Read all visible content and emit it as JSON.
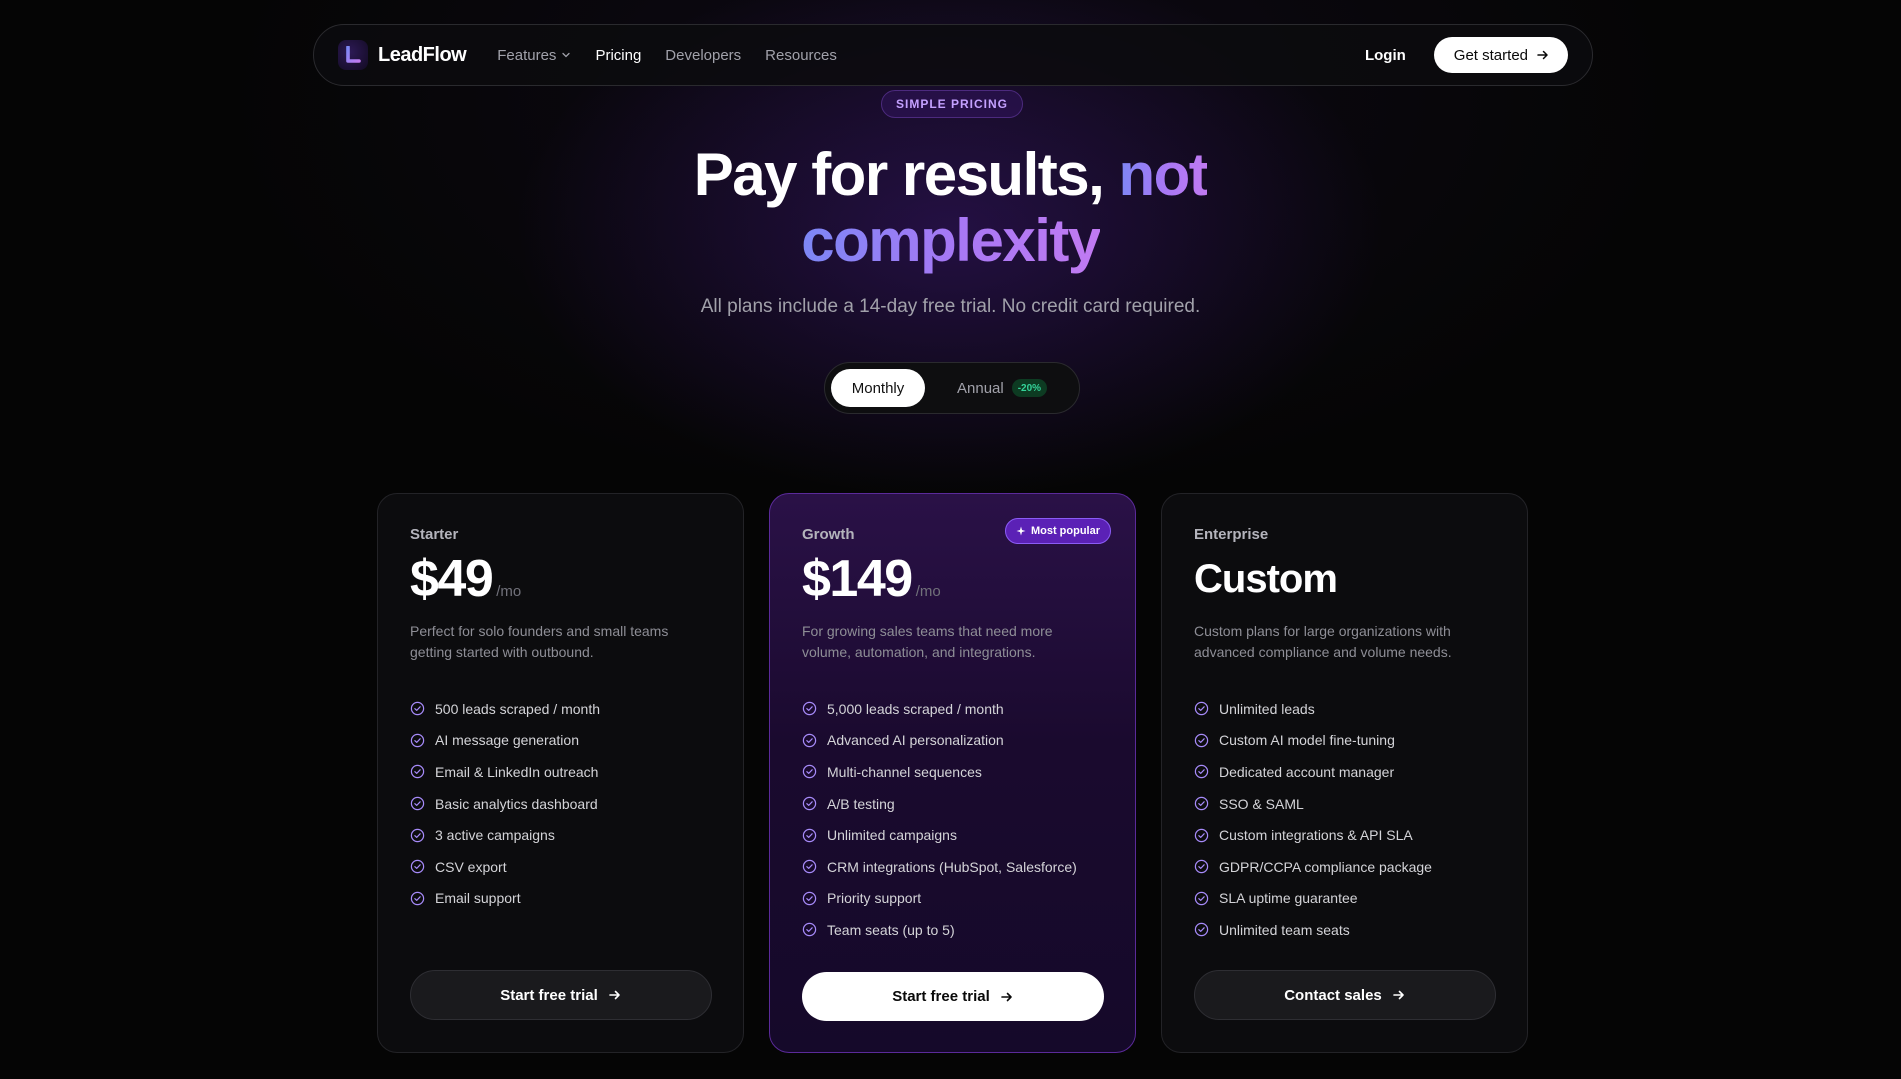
{
  "brand": {
    "name": "LeadFlow",
    "logo_icon": "leadflow-logo"
  },
  "nav": {
    "links": [
      {
        "label": "Features",
        "has_dropdown": true
      },
      {
        "label": "Pricing",
        "active": true
      },
      {
        "label": "Developers"
      },
      {
        "label": "Resources"
      }
    ],
    "login": "Login",
    "cta": "Get started"
  },
  "hero": {
    "badge": "SIMPLE PRICING",
    "title_plain": "Pay for results, ",
    "title_accent_1": "not",
    "title_accent_2": "complexity",
    "subtitle": "All plans include a 14-day free trial. No credit card required."
  },
  "billing_toggle": {
    "selected": "Monthly",
    "monthly": "Monthly",
    "annual": "Annual",
    "annual_discount": "-20%"
  },
  "plans": [
    {
      "name": "Starter",
      "price": "$49",
      "period": "/mo",
      "description": "Perfect for solo founders and small teams getting started with outbound.",
      "features": [
        "500 leads scraped / month",
        "AI message generation",
        "Email & LinkedIn outreach",
        "Basic analytics dashboard",
        "3 active campaigns",
        "CSV export",
        "Email support"
      ],
      "cta": "Start free trial"
    },
    {
      "name": "Growth",
      "price": "$149",
      "period": "/mo",
      "badge": "Most popular",
      "description": "For growing sales teams that need more volume, automation, and integrations.",
      "features": [
        "5,000 leads scraped / month",
        "Advanced AI personalization",
        "Multi-channel sequences",
        "A/B testing",
        "Unlimited campaigns",
        "CRM integrations (HubSpot, Salesforce)",
        "Priority support",
        "Team seats (up to 5)"
      ],
      "cta": "Start free trial"
    },
    {
      "name": "Enterprise",
      "price": "Custom",
      "description": "Custom plans for large organizations with advanced compliance and volume needs.",
      "features": [
        "Unlimited leads",
        "Custom AI model fine-tuning",
        "Dedicated account manager",
        "SSO & SAML",
        "Custom integrations & API SLA",
        "GDPR/CCPA compliance package",
        "SLA uptime guarantee",
        "Unlimited team seats"
      ],
      "cta": "Contact sales"
    }
  ],
  "colors": {
    "background": "#050505",
    "accent_purple": "#a678f5",
    "accent_indigo": "#7c87f5",
    "check_color": "#a78bfa",
    "discount_green": "#34d399"
  }
}
